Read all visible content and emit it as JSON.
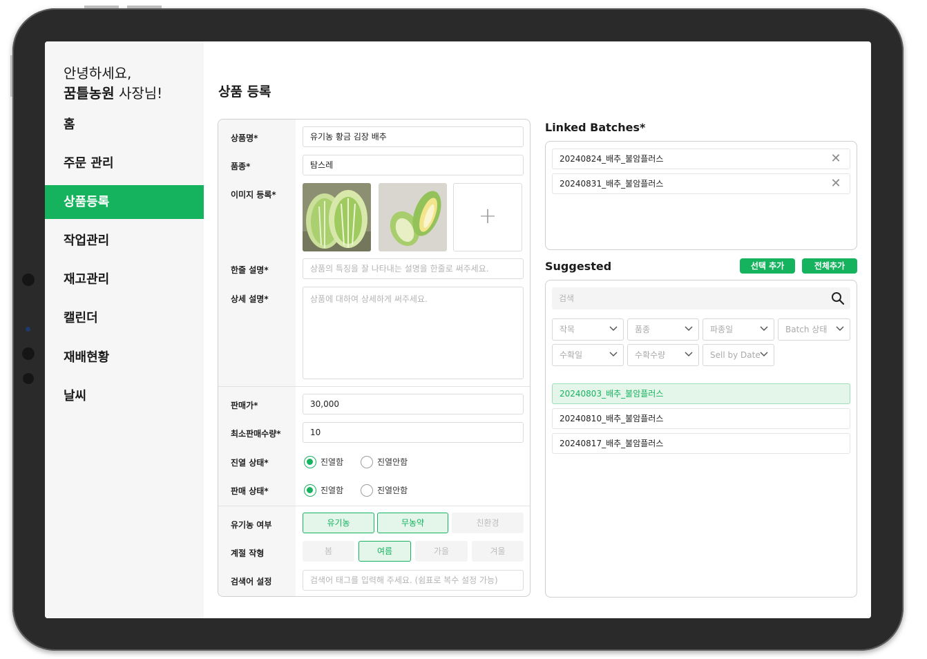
{
  "sidebar": {
    "greeting_line1": "안녕하세요,",
    "farm_name": "꿈틀농원",
    "greeting_suffix": " 사장님!",
    "items": [
      {
        "label": "홈"
      },
      {
        "label": "주문 관리"
      },
      {
        "label": "상품등록",
        "active": true
      },
      {
        "label": "작업관리"
      },
      {
        "label": "재고관리"
      },
      {
        "label": "캘린더"
      },
      {
        "label": "재배현황"
      },
      {
        "label": "날씨"
      }
    ]
  },
  "page": {
    "title": "상품 등록"
  },
  "form": {
    "product_name": {
      "label": "상품명*",
      "value": "유기농 황금 김장 배추"
    },
    "variety": {
      "label": "품종*",
      "value": "탐스레"
    },
    "images": {
      "label": "이미지 등록*",
      "count": 2,
      "add_icon": "+"
    },
    "short_desc": {
      "label": "한줄 설명*",
      "placeholder": "상품의 특징을 잘 나타내는 설명을 한줄로 써주세요."
    },
    "detail_desc": {
      "label": "상세 설명*",
      "placeholder": "상품에 대하여 상세하게 써주세요."
    },
    "price": {
      "label": "판매가*",
      "value": "30,000"
    },
    "min_qty": {
      "label": "최소판매수량*",
      "value": "10"
    },
    "display_status": {
      "label": "진열 상태*",
      "options": [
        "진열함",
        "진열안함"
      ],
      "selected": "진열함"
    },
    "sale_status": {
      "label": "판매 상태*",
      "options": [
        "진열함",
        "진열안함"
      ],
      "selected": "진열함"
    },
    "organic": {
      "label": "유기농 여부",
      "options": [
        {
          "label": "유기농",
          "on": true
        },
        {
          "label": "무농약",
          "on": true
        },
        {
          "label": "친환경",
          "on": false
        }
      ]
    },
    "season": {
      "label": "계절 작형",
      "options": [
        {
          "label": "봄",
          "on": false
        },
        {
          "label": "여름",
          "on": true
        },
        {
          "label": "가을",
          "on": false
        },
        {
          "label": "겨울",
          "on": false
        }
      ]
    },
    "keywords": {
      "label": "검색어 설정",
      "placeholder": "검색어 태그를 입력해 주세요. (쉼표로 복수 설정 가능)"
    }
  },
  "linked": {
    "title": "Linked Batches*",
    "items": [
      "20240824_배추_불암플러스",
      "20240831_배추_불암플러스"
    ],
    "remove_icon": "close-icon"
  },
  "suggested": {
    "title": "Suggested",
    "add_selected_label": "선택 추가",
    "add_all_label": "전체추가",
    "search_placeholder": "검색",
    "filters": [
      "작목",
      "품종",
      "파종일",
      "Batch 상태",
      "수확일",
      "수확수량",
      "Sell by Date"
    ],
    "items": [
      {
        "label": "20240803_배추_불암플러스",
        "selected": true
      },
      {
        "label": "20240810_배추_불암플러스",
        "selected": false
      },
      {
        "label": "20240817_배추_불암플러스",
        "selected": false
      }
    ]
  },
  "colors": {
    "accent": "#16b35e",
    "accent_light": "#e4f5ea",
    "sidebar_bg": "#f6f6f6",
    "bezel": "#2a2a2a"
  }
}
